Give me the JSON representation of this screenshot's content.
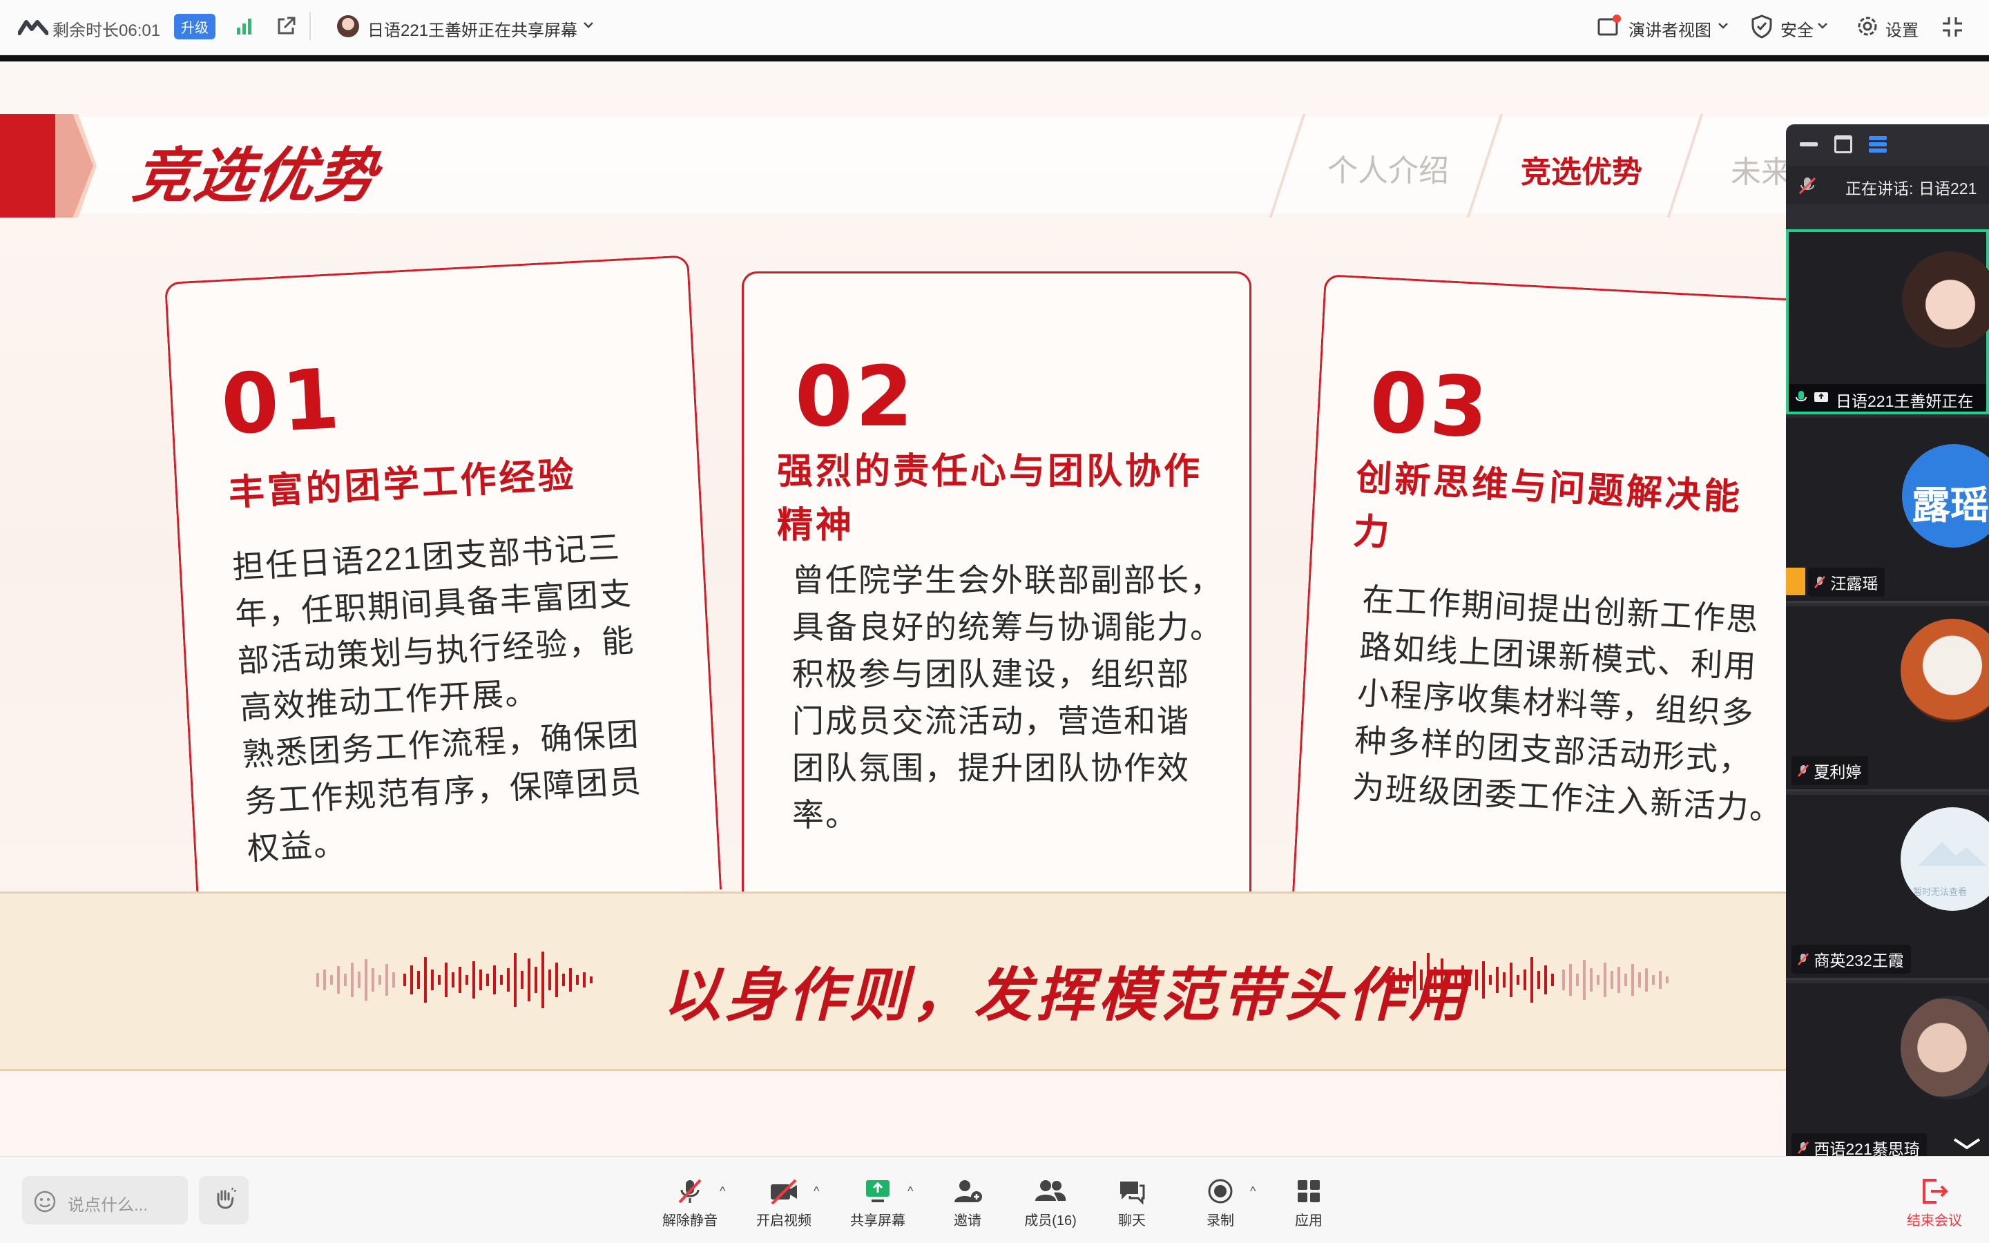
{
  "topbar": {
    "remaining_label": "剩余时长06:01",
    "upgrade_label": "升级",
    "sharing_notice": "日语221王善妍正在共享屏幕",
    "presenter_view_label": "演讲者视图",
    "security_label": "安全",
    "settings_label": "设置"
  },
  "slide": {
    "title": "竞选优势",
    "nav_tabs": [
      {
        "label": "个人介绍",
        "active": false
      },
      {
        "label": "竞选优势",
        "active": true
      },
      {
        "label": "未来",
        "active": false
      }
    ],
    "cards": [
      {
        "number": "01",
        "title_lines": [
          "丰富的团学工作经验"
        ],
        "body_lines": [
          "担任日语221团支部书记三",
          "年，任职期间具备丰富团支",
          "部活动策划与执行经验，能",
          "高效推动工作开展。",
          "熟悉团务工作流程，确保团",
          "务工作规范有序，保障团员",
          "权益。"
        ]
      },
      {
        "number": "02",
        "title_lines": [
          "强烈的责任心与团队协作",
          "精神"
        ],
        "body_lines": [
          "曾任院学生会外联部副部长，",
          "具备良好的统筹与协调能力。",
          "积极参与团队建设，组织部",
          "门成员交流活动，营造和谐",
          "团队氛围，提升团队协作效",
          "率。"
        ]
      },
      {
        "number": "03",
        "title_lines": [
          "创新思维与问题解决能",
          "力"
        ],
        "body_lines": [
          "在工作期间提出创新工作思",
          "路如线上团课新模式、利用",
          "小程序收集材料等，组织多",
          "种多样的团支部活动形式，",
          "为班级团委工作注入新活力。"
        ]
      }
    ],
    "slogan": "以身作则，发挥模范带头作用"
  },
  "panel": {
    "speaking_label": "正在讲话:",
    "speaking_name": "日语221",
    "participants": [
      {
        "name": "日语221王善妍正在",
        "avatar_text": "",
        "highlight": true
      },
      {
        "name": "汪露瑶",
        "avatar_text": "露瑶",
        "highlight": false
      },
      {
        "name": "夏利婷",
        "avatar_text": "",
        "highlight": false
      },
      {
        "name": "商英232王霞",
        "avatar_text": "",
        "avatar_caption": "暂时无法查看",
        "highlight": false
      },
      {
        "name": "西语221綦思琦",
        "avatar_text": "",
        "highlight": false
      }
    ]
  },
  "bottombar": {
    "chat_placeholder": "说点什么...",
    "tools": [
      {
        "label": "解除静音",
        "icon": "mic-muted-icon"
      },
      {
        "label": "开启视频",
        "icon": "video-off-icon"
      },
      {
        "label": "共享屏幕",
        "icon": "share-screen-icon"
      },
      {
        "label": "邀请",
        "icon": "invite-icon"
      },
      {
        "label": "成员(16)",
        "icon": "members-icon"
      },
      {
        "label": "聊天",
        "icon": "chat-icon"
      },
      {
        "label": "录制",
        "icon": "record-icon"
      },
      {
        "label": "应用",
        "icon": "apps-icon"
      }
    ],
    "end_label": "结束会议"
  },
  "colors": {
    "accent_red": "#c8131b",
    "panel_bg": "#2d2d33",
    "active_speaker_border": "#1fcf8c",
    "upgrade_blue": "#3b7ee8"
  }
}
